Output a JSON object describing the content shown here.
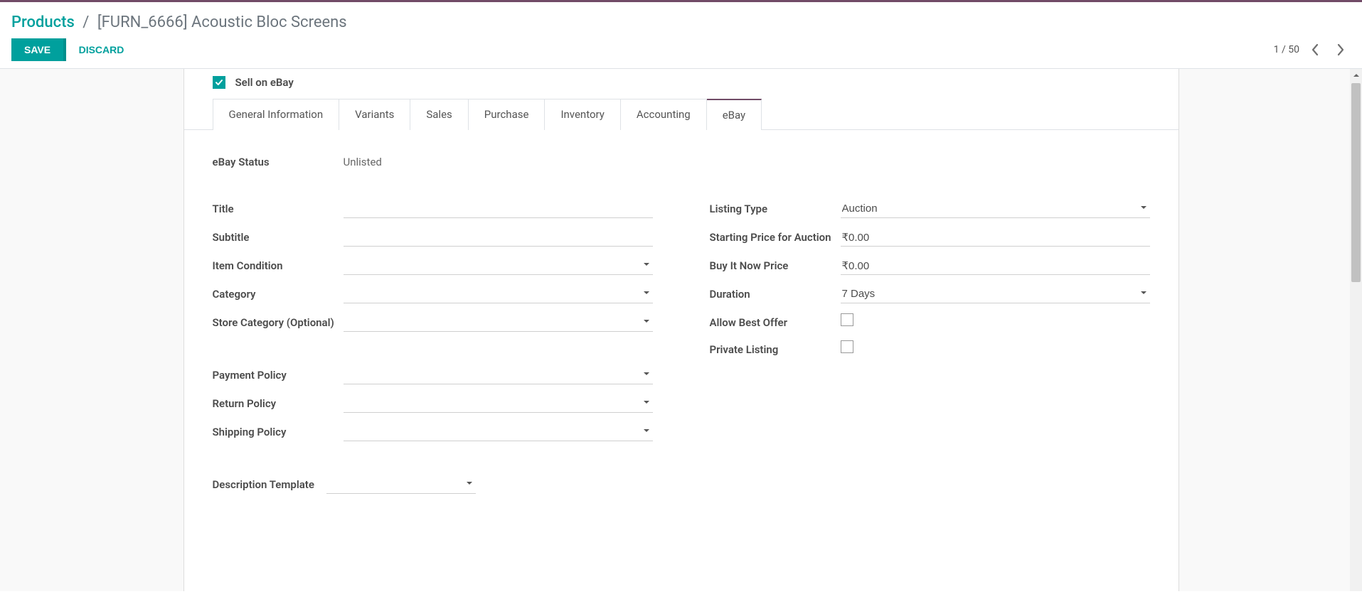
{
  "breadcrumb": {
    "root": "Products",
    "current": "[FURN_6666] Acoustic Bloc Screens"
  },
  "actions": {
    "save": "SAVE",
    "discard": "DISCARD"
  },
  "pager": {
    "position": "1",
    "total": "50"
  },
  "sell_on_ebay_label": "Sell on eBay",
  "tabs": [
    "General Information",
    "Variants",
    "Sales",
    "Purchase",
    "Inventory",
    "Accounting",
    "eBay"
  ],
  "active_tab": "eBay",
  "ebay": {
    "status_label": "eBay Status",
    "status_value": "Unlisted",
    "left": {
      "title_label": "Title",
      "title_value": "",
      "subtitle_label": "Subtitle",
      "subtitle_value": "",
      "item_condition_label": "Item Condition",
      "item_condition_value": "",
      "category_label": "Category",
      "category_value": "",
      "store_category_label": "Store Category (Optional)",
      "store_category_value": "",
      "payment_policy_label": "Payment Policy",
      "payment_policy_value": "",
      "return_policy_label": "Return Policy",
      "return_policy_value": "",
      "shipping_policy_label": "Shipping Policy",
      "shipping_policy_value": "",
      "description_template_label": "Description Template",
      "description_template_value": ""
    },
    "right": {
      "listing_type_label": "Listing Type",
      "listing_type_value": "Auction",
      "starting_price_label": "Starting Price for Auction",
      "starting_price_value": "₹0.00",
      "buy_now_label": "Buy It Now Price",
      "buy_now_value": "₹0.00",
      "duration_label": "Duration",
      "duration_value": "7 Days",
      "allow_best_offer_label": "Allow Best Offer",
      "private_listing_label": "Private Listing"
    }
  }
}
